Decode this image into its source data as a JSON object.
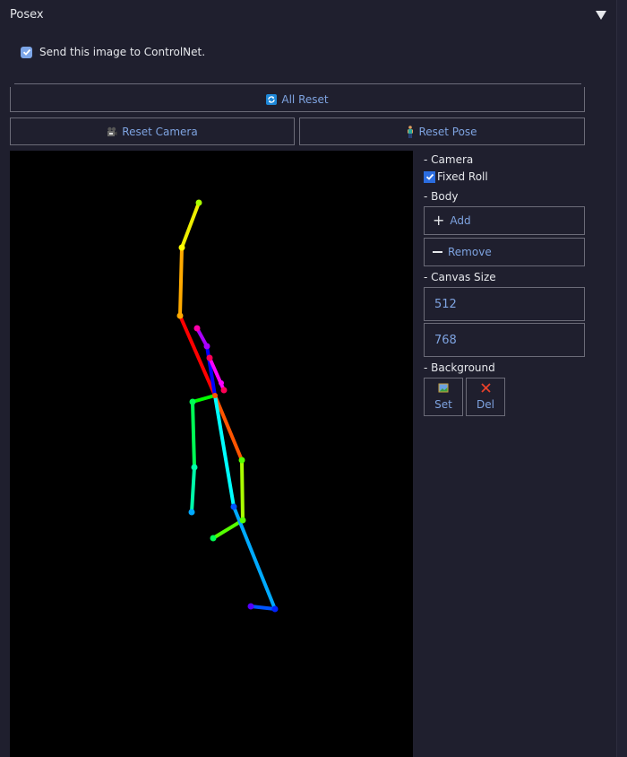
{
  "panel": {
    "title": "Posex",
    "collapse_icon": "triangle-down"
  },
  "send_to_controlnet": {
    "label": "Send this image to ControlNet.",
    "checked": true
  },
  "buttons": {
    "all_reset": {
      "label": "All Reset",
      "icon": "refresh-icon"
    },
    "reset_camera": {
      "label": "Reset Camera",
      "icon": "camera-icon"
    },
    "reset_pose": {
      "label": "Reset Pose",
      "icon": "person-icon"
    }
  },
  "sidebar": {
    "camera": {
      "heading": "- Camera",
      "fixed_roll": {
        "label": "Fixed Roll",
        "checked": true
      }
    },
    "body": {
      "heading": "- Body",
      "add_label": "Add",
      "remove_label": "Remove"
    },
    "canvas_size": {
      "heading": "- Canvas Size",
      "width": "512",
      "height": "768"
    },
    "background": {
      "heading": "- Background",
      "set_label": "Set",
      "del_label": "Del"
    }
  },
  "canvas": {
    "background": "#000000",
    "pose_colors": {
      "red": "#ff0000",
      "orange": "#ffaa00",
      "yellow": "#ffff00",
      "green": "#00ff00",
      "cyan": "#00ffff",
      "blue": "#0000ff",
      "magenta": "#ff00ff"
    }
  }
}
